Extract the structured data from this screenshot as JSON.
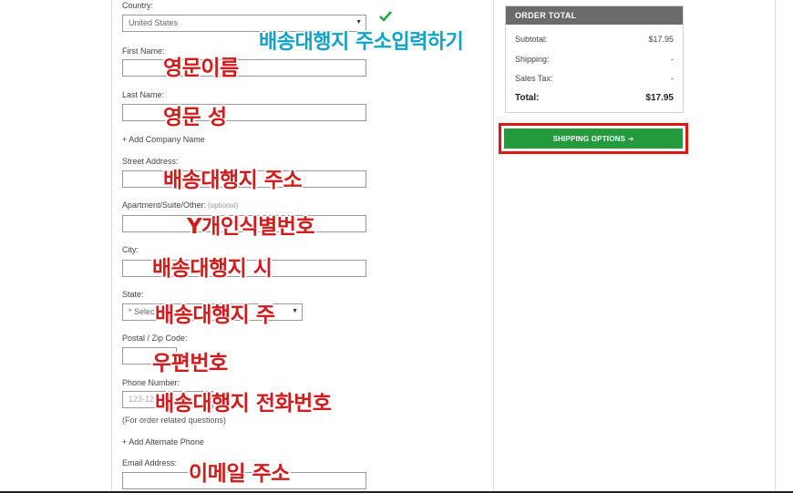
{
  "form": {
    "country_label": "Country:",
    "country_value": "United States",
    "first_name_label": "First Name:",
    "last_name_label": "Last Name:",
    "add_company": "+ Add Company Name",
    "street_label": "Street Address:",
    "apt_label": "Apartment/Suite/Other:",
    "apt_optional": "(optional)",
    "city_label": "City:",
    "state_label": "State:",
    "state_value": "* Select",
    "zip_label": "Postal / Zip Code:",
    "phone_label": "Phone Number:",
    "phone_placeholder": "123-123-1234",
    "phone_hint": "(For order related questions)",
    "add_alt_phone": "+ Add Alternate Phone",
    "email_label": "Email Address:"
  },
  "annotations": {
    "address_input": "배송대행지 주소입력하기",
    "first_name": "영문이름",
    "last_name": "영문 성",
    "street": "배송대행지 주소",
    "apt": "Y개인식별번호",
    "city": "배송대행지 시",
    "state": "배송대행지 주",
    "zip": "우편번호",
    "phone": "배송대행지 전화번호",
    "email": "이메일 주소"
  },
  "order_total": {
    "title": "ORDER TOTAL",
    "subtotal_label": "Subtotal:",
    "subtotal_value": "$17.95",
    "shipping_label": "Shipping:",
    "shipping_value": "-",
    "tax_label": "Sales Tax:",
    "tax_value": "-",
    "total_label": "Total:",
    "total_value": "$17.95"
  },
  "shipping_button": {
    "label": "SHIPPING OPTIONS ➔"
  },
  "colors": {
    "annotation_red": "#d01c1c",
    "annotation_blue": "#11a3c7",
    "button_green": "#239b3d",
    "highlight_red": "#e01717"
  }
}
